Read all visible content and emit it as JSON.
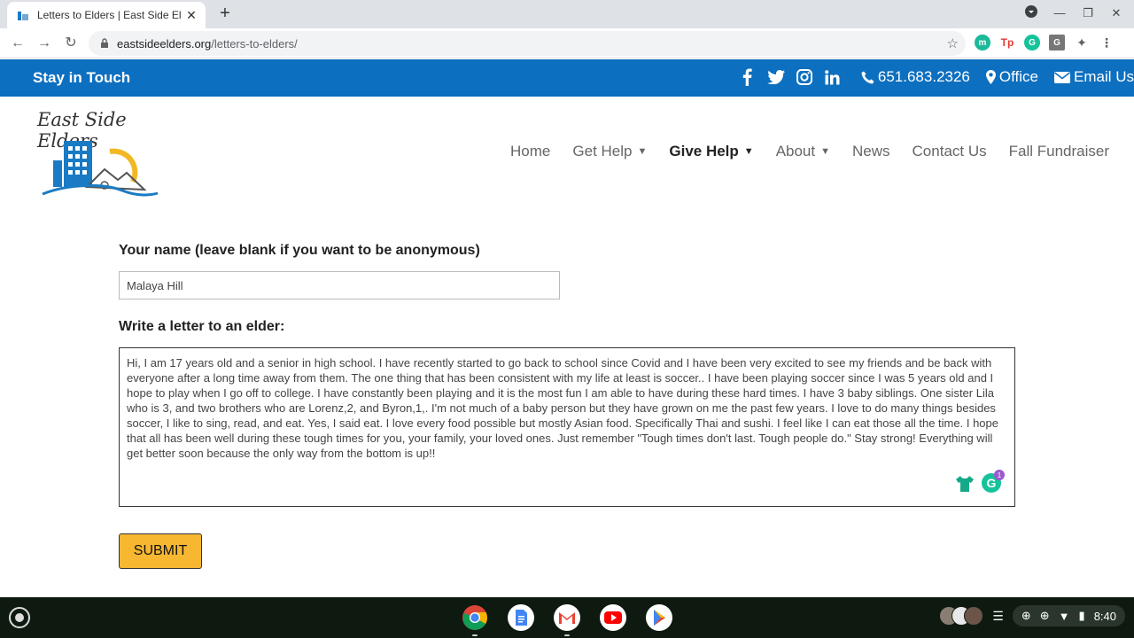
{
  "browser": {
    "tab_title": "Letters to Elders | East Side Elders",
    "new_tab": "+",
    "url_domain": "eastsideelders.org",
    "url_path": "/letters-to-elders/"
  },
  "topbar": {
    "stay_in_touch": "Stay in Touch",
    "phone": "651.683.2326",
    "office": "Office",
    "email": "Email Us"
  },
  "header": {
    "logo_text": "East Side Elders",
    "nav": {
      "home": "Home",
      "get_help": "Get Help",
      "give_help": "Give Help",
      "about": "About",
      "news": "News",
      "contact": "Contact Us",
      "fundraiser": "Fall Fundraiser"
    }
  },
  "form": {
    "name_label": "Your name (leave blank if you want to be anonymous)",
    "name_value": "Malaya Hill",
    "letter_label": "Write a letter to an elder:",
    "letter_value": "Hi, I am 17 years old and a senior in high school. I have recently started to go back to school since Covid and I have been very excited to see my friends and be back with everyone after a long time away from them. The one thing that has been consistent with my life at least is soccer.. I have been playing soccer since I was 5 years old and I hope to play when I go off to college. I have constantly been playing and it is the most fun I am able to have during these hard times. I have 3 baby siblings. One sister Lila who is 3, and two brothers who are Lorenz,2, and Byron,1,. I'm not much of a baby person but they have grown on me the past few years. I love to do many things besides soccer, I like to sing, read, and eat. Yes, I said eat. I love every food possible but mostly Asian food. Specifically Thai and sushi. I feel like I can eat those all the time. I hope that all has been well during these tough times for you, your family, your loved ones. Just remember \"Tough times don't last. Tough people do.\" Stay strong! Everything will get better soon because the only way from the bottom is up!!",
    "grammarly_count": "1",
    "submit": "SUBMIT"
  },
  "shelf": {
    "time": "8:40"
  }
}
